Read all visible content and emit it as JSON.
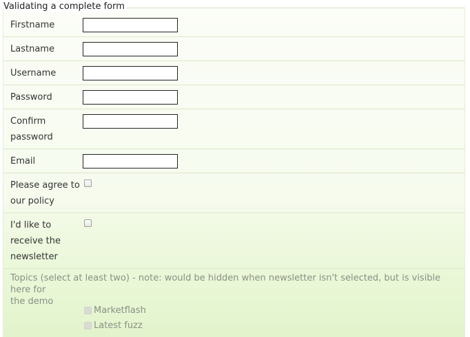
{
  "form": {
    "legend": "Validating a complete form",
    "fields": {
      "firstname": {
        "label": "Firstname",
        "value": ""
      },
      "lastname": {
        "label": "Lastname",
        "value": ""
      },
      "username": {
        "label": "Username",
        "value": ""
      },
      "password": {
        "label": "Password",
        "value": ""
      },
      "confirm_password": {
        "label_line1": "Confirm",
        "label_line2": "password",
        "value": ""
      },
      "email": {
        "label": "Email",
        "value": ""
      },
      "agree": {
        "label_line1": "Please agree to",
        "label_line2": "our policy",
        "checked": false
      },
      "newsletter": {
        "label_line1": "I'd like to",
        "label_line2": "receive the",
        "label_line3": "newsletter",
        "checked": false
      }
    },
    "topics": {
      "note_line1": "Topics (select at least two) - note: would be hidden when newsletter isn't selected, but is visible here for",
      "note_line2": "the demo",
      "options": [
        {
          "label": "Marketflash",
          "checked": false
        },
        {
          "label": "Latest fuzz",
          "checked": false
        }
      ]
    }
  }
}
